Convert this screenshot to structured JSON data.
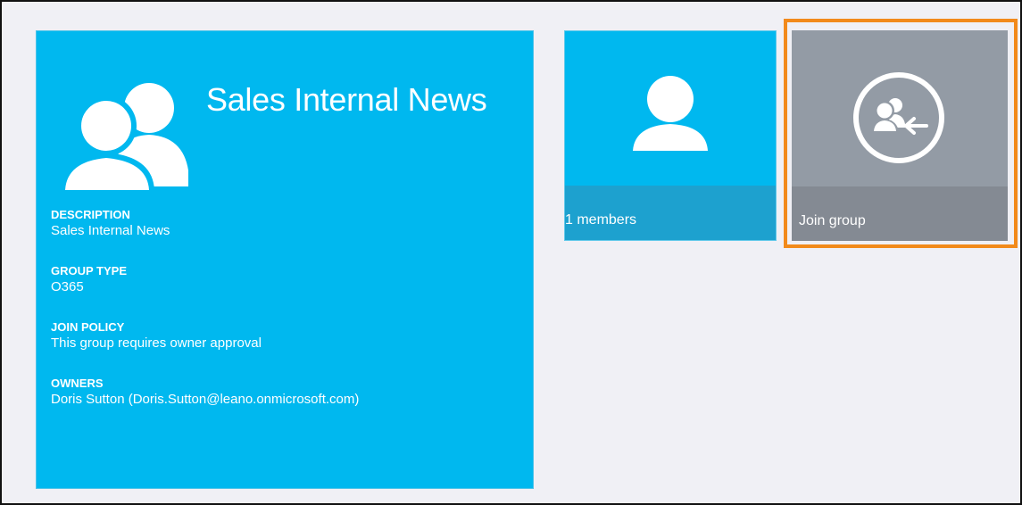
{
  "group": {
    "title": "Sales Internal News",
    "icon": "group-people-icon",
    "fields": {
      "description": {
        "label": "DESCRIPTION",
        "value": "Sales Internal News"
      },
      "group_type": {
        "label": "GROUP TYPE",
        "value": "O365"
      },
      "join_policy": {
        "label": "JOIN POLICY",
        "value": "This group requires owner approval"
      },
      "owners": {
        "label": "OWNERS",
        "value": "Doris Sutton (Doris.Sutton@leano.onmicrosoft.com)"
      }
    }
  },
  "members_tile": {
    "label": "1 members",
    "icon": "person-icon"
  },
  "join_tile": {
    "label": "Join group",
    "icon": "join-group-icon",
    "highlight_color": "#f28a1b"
  },
  "colors": {
    "tile_blue": "#00b8ef",
    "tile_blue_footer": "#1da1cf",
    "tile_gray": "#939ba5",
    "tile_gray_footer": "#848a93",
    "background": "#f0f0f5"
  }
}
